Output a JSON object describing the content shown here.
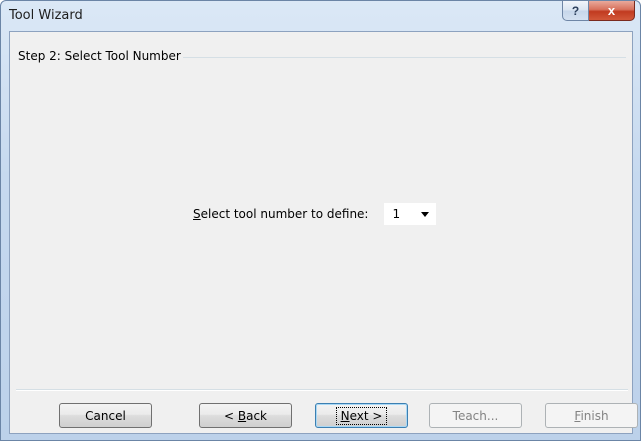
{
  "window": {
    "title": "Tool Wizard",
    "help_glyph": "?",
    "close_glyph": "x"
  },
  "step": {
    "title": "Step 2: Select Tool Number"
  },
  "field": {
    "label_accel": "S",
    "label_rest": "elect tool number to define:",
    "selected_value": "1"
  },
  "buttons": {
    "cancel": "Cancel",
    "back_prefix": "< ",
    "back_accel": "B",
    "back_rest": "ack",
    "next_accel": "N",
    "next_rest": "ext >",
    "teach": "Teach...",
    "finish_accel": "F",
    "finish_rest": "inish"
  }
}
